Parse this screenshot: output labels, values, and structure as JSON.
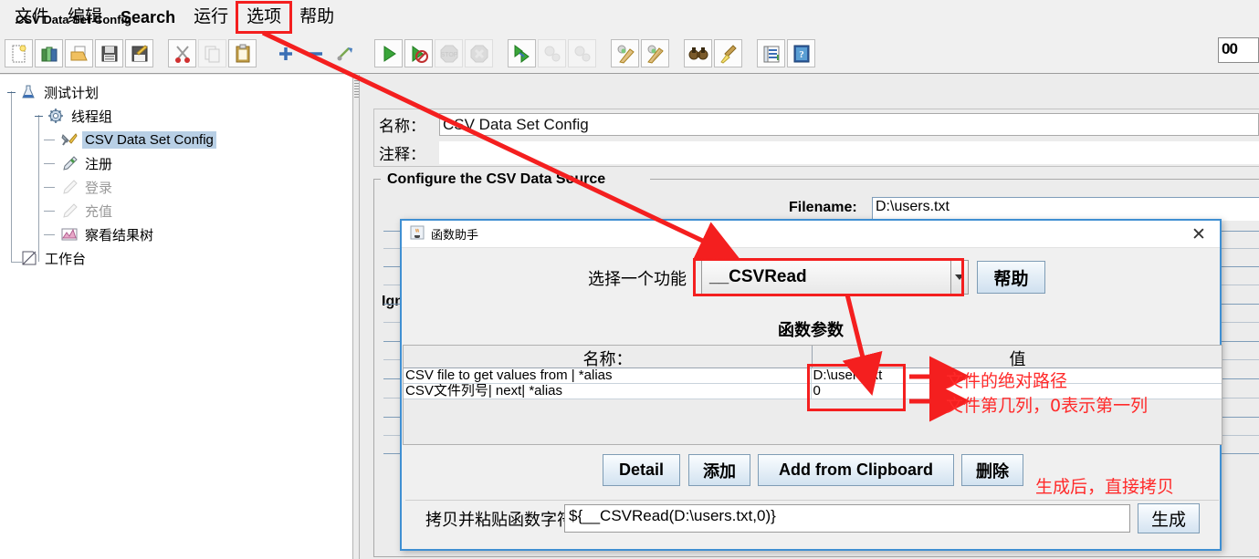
{
  "menu": {
    "items": [
      {
        "label": "文件",
        "boxed": false,
        "latin": false
      },
      {
        "label": "编辑",
        "boxed": false,
        "latin": false
      },
      {
        "label": "Search",
        "boxed": false,
        "latin": true
      },
      {
        "label": "运行",
        "boxed": false,
        "latin": false
      },
      {
        "label": "选项",
        "boxed": true,
        "latin": false
      },
      {
        "label": "帮助",
        "boxed": false,
        "latin": false
      }
    ]
  },
  "toolbar": {
    "counter_value": "00",
    "buttons": [
      {
        "icon": "new-document-icon",
        "enabled": true
      },
      {
        "icon": "templates-icon",
        "enabled": true
      },
      {
        "icon": "open-folder-icon",
        "enabled": true
      },
      {
        "icon": "save-icon",
        "enabled": true
      },
      {
        "icon": "save-as-icon",
        "enabled": true
      },
      {
        "icon": "cut-scissors-icon",
        "enabled": true
      },
      {
        "icon": "copy-icon",
        "enabled": false
      },
      {
        "icon": "paste-clipboard-icon",
        "enabled": true
      },
      {
        "icon": "expand-plus-icon",
        "enabled": true
      },
      {
        "icon": "collapse-minus-icon",
        "enabled": true
      },
      {
        "icon": "toggle-icon",
        "enabled": true
      },
      {
        "icon": "start-play-icon",
        "enabled": true
      },
      {
        "icon": "start-no-pauses-icon",
        "enabled": true
      },
      {
        "icon": "stop-icon",
        "enabled": false
      },
      {
        "icon": "shutdown-icon",
        "enabled": false
      },
      {
        "icon": "remote-start-icon",
        "enabled": true
      },
      {
        "icon": "remote-stop-icon",
        "enabled": false
      },
      {
        "icon": "remote-shutdown-icon",
        "enabled": false
      },
      {
        "icon": "clear-icon",
        "enabled": true
      },
      {
        "icon": "clear-all-icon",
        "enabled": true
      },
      {
        "icon": "search-binoculars-icon",
        "enabled": true
      },
      {
        "icon": "reset-search-broom-icon",
        "enabled": true
      },
      {
        "icon": "function-helper-list-icon",
        "enabled": true
      },
      {
        "icon": "help-book-icon",
        "enabled": true
      }
    ]
  },
  "tree": {
    "nodes": [
      {
        "label": "测试计划",
        "icon": "test-plan-icon",
        "depth": 0,
        "selected": false,
        "disabled": false
      },
      {
        "label": "线程组",
        "icon": "thread-group-icon",
        "depth": 1,
        "selected": false,
        "disabled": false
      },
      {
        "label": "CSV Data Set Config",
        "icon": "config-element-icon",
        "depth": 2,
        "selected": true,
        "disabled": false
      },
      {
        "label": "注册",
        "icon": "http-sampler-icon",
        "depth": 2,
        "selected": false,
        "disabled": false
      },
      {
        "label": "登录",
        "icon": "http-sampler-disabled-icon",
        "depth": 2,
        "selected": false,
        "disabled": true
      },
      {
        "label": "充值",
        "icon": "http-sampler-disabled-icon",
        "depth": 2,
        "selected": false,
        "disabled": true
      },
      {
        "label": "察看结果树",
        "icon": "view-results-tree-icon",
        "depth": 2,
        "selected": false,
        "disabled": false
      },
      {
        "label": "工作台",
        "icon": "workbench-icon",
        "depth": 0,
        "selected": false,
        "disabled": false
      }
    ]
  },
  "panel": {
    "title": "CSV Data Set Config",
    "name_label": "名称：",
    "name_value": "CSV Data Set Config",
    "comment_label": "注释：",
    "comment_value": "",
    "group_title": "Configure the CSV Data Source",
    "filename_label": "Filename:",
    "filename_value": "D:\\users.txt",
    "ignore_label": "Ign"
  },
  "dialog": {
    "title": "函数助手",
    "title_icon": "java-coffee-icon",
    "close_icon": "close-x-icon",
    "select_function_label": "选择一个功能",
    "selected_function": "__CSVRead",
    "help_button": "帮助",
    "params_title": "函数参数",
    "table": {
      "headers": [
        "名称：",
        "值"
      ],
      "rows": [
        {
          "name": "CSV file to get values from | *alias",
          "value": "D:\\users.txt"
        },
        {
          "name": "CSV文件列号| next| *alias",
          "value": "0"
        }
      ]
    },
    "buttons": {
      "detail": "Detail",
      "add": "添加",
      "add_from_clipboard": "Add from Clipboard",
      "delete": "删除",
      "generate": "生成"
    },
    "copy_label": "拷贝并粘贴函数字符串",
    "copy_value": "${__CSVRead(D:\\users.txt,0)}"
  },
  "annotations": {
    "note_path": "文件的绝对路径",
    "note_column": "文件第几列，0表示第一列",
    "note_generate": "生成后，直接拷贝"
  },
  "colors": {
    "accent_red": "#f41f1f",
    "annotation_red": "#ff2a2a",
    "dialog_border_blue": "#3f8fd2",
    "tree_selection": "#b8cfe5",
    "panel_bg": "#ececec"
  }
}
